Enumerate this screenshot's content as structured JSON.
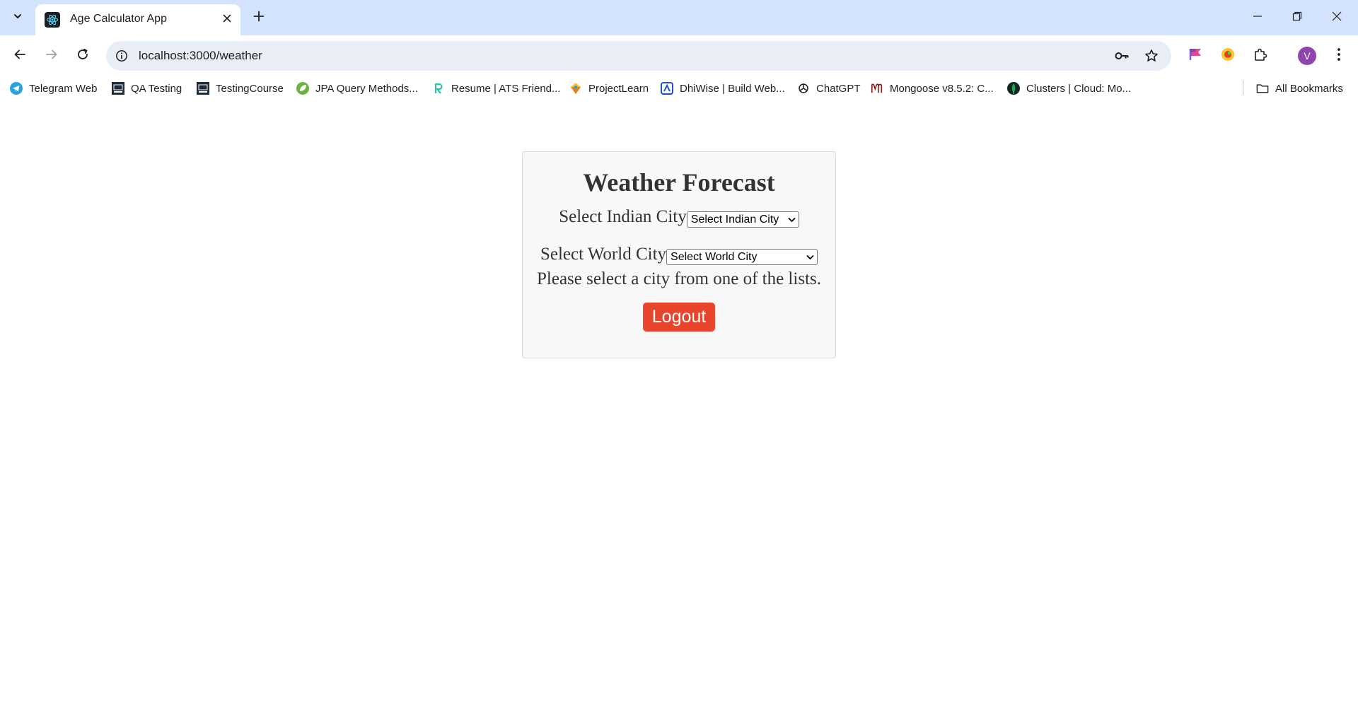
{
  "browser": {
    "tab": {
      "title": "Age Calculator App",
      "favicon": "react-atom-icon"
    },
    "omnibox": {
      "url": "localhost:3000/weather"
    },
    "profile": {
      "initial": "V",
      "color": "#8e44ad"
    },
    "bookmarks": [
      {
        "label": "Telegram Web",
        "icon": "telegram-icon"
      },
      {
        "label": "QA Testing",
        "icon": "qa-testing-icon"
      },
      {
        "label": "TestingCourse",
        "icon": "testing-course-icon"
      },
      {
        "label": "JPA Query Methods...",
        "icon": "spring-leaf-icon"
      },
      {
        "label": "Resume | ATS Friend...",
        "icon": "resume-r-icon"
      },
      {
        "label": "ProjectLearn",
        "icon": "project-learn-icon"
      },
      {
        "label": "DhiWise | Build Web...",
        "icon": "dhiwise-icon"
      },
      {
        "label": "ChatGPT",
        "icon": "chatgpt-icon"
      },
      {
        "label": "Mongoose v8.5.2: C...",
        "icon": "mongoose-icon"
      },
      {
        "label": "Clusters | Cloud: Mo...",
        "icon": "mongodb-leaf-icon"
      }
    ],
    "all_bookmarks_label": "All Bookmarks"
  },
  "page": {
    "title": "Weather Forecast",
    "indian_city": {
      "label": "Select Indian City",
      "selected": "Select Indian City"
    },
    "world_city": {
      "label": "Select World City",
      "selected": "Select World City"
    },
    "message": "Please select a city from one of the lists.",
    "logout_label": "Logout"
  },
  "colors": {
    "logout_button": "#e8452c",
    "card_background": "#f8f8f8",
    "tabstrip": "#d3e3fd"
  }
}
